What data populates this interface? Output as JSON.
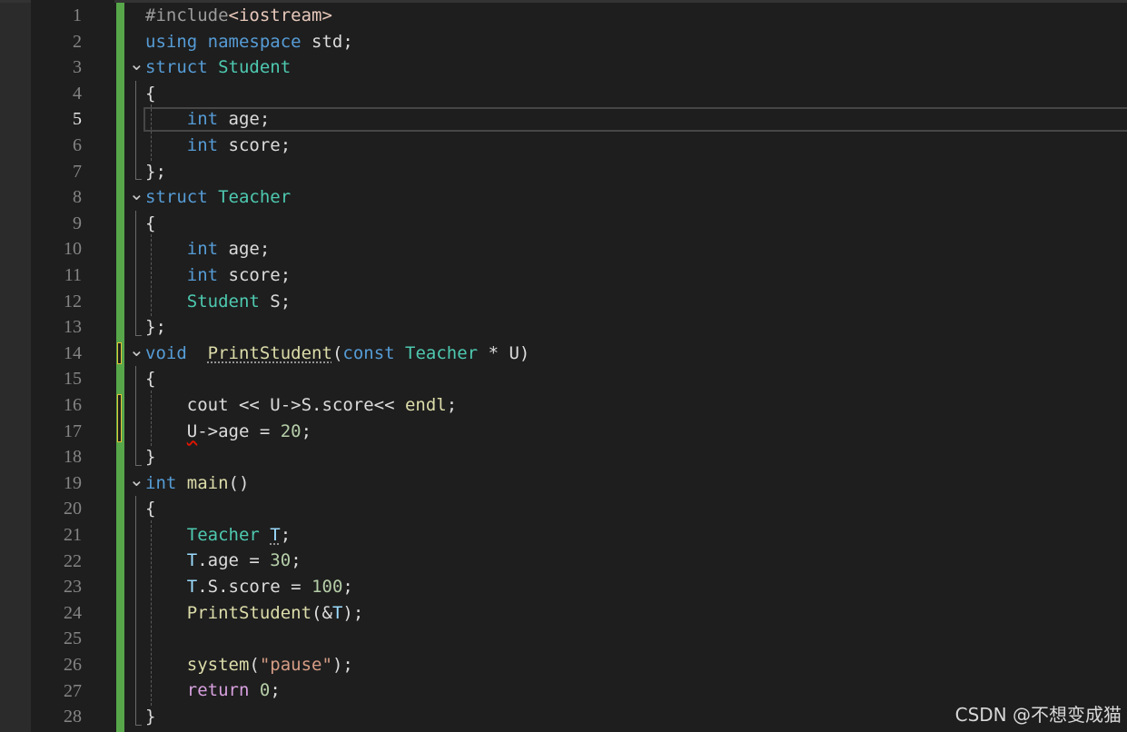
{
  "editor": {
    "current_line": 5,
    "colors": {
      "background": "#1e1e1e",
      "change_bar_saved": "#57a64a",
      "change_bar_unsaved": "#e5c23a",
      "keyword": "#569cd6",
      "type": "#4ec9b0",
      "function": "#dcdcaa",
      "string": "#d69d85",
      "number": "#b5cea8"
    },
    "lines": [
      {
        "n": "1",
        "tokens": [
          {
            "t": "#include",
            "c": "pp"
          },
          {
            "t": "<iostream>",
            "c": "inc"
          }
        ]
      },
      {
        "n": "2",
        "tokens": [
          {
            "t": "using",
            "c": "kw"
          },
          {
            "t": " ",
            "c": "id"
          },
          {
            "t": "namespace",
            "c": "kw"
          },
          {
            "t": " std;",
            "c": "id"
          }
        ]
      },
      {
        "n": "3",
        "tokens": [
          {
            "t": "struct",
            "c": "kw"
          },
          {
            "t": " ",
            "c": "id"
          },
          {
            "t": "Student",
            "c": "type"
          }
        ]
      },
      {
        "n": "4",
        "tokens": [
          {
            "t": "{",
            "c": "id"
          }
        ]
      },
      {
        "n": "5",
        "tokens": [
          {
            "t": "    ",
            "c": "id"
          },
          {
            "t": "int",
            "c": "kw"
          },
          {
            "t": " age;",
            "c": "id"
          }
        ]
      },
      {
        "n": "6",
        "tokens": [
          {
            "t": "    ",
            "c": "id"
          },
          {
            "t": "int",
            "c": "kw"
          },
          {
            "t": " score;",
            "c": "id"
          }
        ]
      },
      {
        "n": "7",
        "tokens": [
          {
            "t": "};",
            "c": "id"
          }
        ]
      },
      {
        "n": "8",
        "tokens": [
          {
            "t": "struct",
            "c": "kw"
          },
          {
            "t": " ",
            "c": "id"
          },
          {
            "t": "Teacher",
            "c": "type"
          }
        ]
      },
      {
        "n": "9",
        "tokens": [
          {
            "t": "{",
            "c": "id"
          }
        ]
      },
      {
        "n": "10",
        "tokens": [
          {
            "t": "    ",
            "c": "id"
          },
          {
            "t": "int",
            "c": "kw"
          },
          {
            "t": " age;",
            "c": "id"
          }
        ]
      },
      {
        "n": "11",
        "tokens": [
          {
            "t": "    ",
            "c": "id"
          },
          {
            "t": "int",
            "c": "kw"
          },
          {
            "t": " score;",
            "c": "id"
          }
        ]
      },
      {
        "n": "12",
        "tokens": [
          {
            "t": "    ",
            "c": "id"
          },
          {
            "t": "Student",
            "c": "type"
          },
          {
            "t": " S;",
            "c": "id"
          }
        ]
      },
      {
        "n": "13",
        "tokens": [
          {
            "t": "};",
            "c": "id"
          }
        ]
      },
      {
        "n": "14",
        "tokens": [
          {
            "t": "void",
            "c": "kw"
          },
          {
            "t": "  ",
            "c": "id"
          },
          {
            "t": "PrintStudent",
            "c": "fn",
            "deco": "dotted"
          },
          {
            "t": "(",
            "c": "id"
          },
          {
            "t": "const",
            "c": "kw"
          },
          {
            "t": " ",
            "c": "id"
          },
          {
            "t": "Teacher",
            "c": "type"
          },
          {
            "t": " * U)",
            "c": "id"
          }
        ]
      },
      {
        "n": "15",
        "tokens": [
          {
            "t": "{",
            "c": "id"
          }
        ]
      },
      {
        "n": "16",
        "tokens": [
          {
            "t": "    cout << U->S.score<< ",
            "c": "id"
          },
          {
            "t": "endl",
            "c": "fn"
          },
          {
            "t": ";",
            "c": "id"
          }
        ]
      },
      {
        "n": "17",
        "tokens": [
          {
            "t": "    ",
            "c": "id"
          },
          {
            "t": "U",
            "c": "id",
            "deco": "squiggle"
          },
          {
            "t": "->age = ",
            "c": "id"
          },
          {
            "t": "20",
            "c": "num"
          },
          {
            "t": ";",
            "c": "id"
          }
        ]
      },
      {
        "n": "18",
        "tokens": [
          {
            "t": "}",
            "c": "id"
          }
        ]
      },
      {
        "n": "19",
        "tokens": [
          {
            "t": "int",
            "c": "kw"
          },
          {
            "t": " ",
            "c": "id"
          },
          {
            "t": "main",
            "c": "fn"
          },
          {
            "t": "()",
            "c": "id"
          }
        ]
      },
      {
        "n": "20",
        "tokens": [
          {
            "t": "{",
            "c": "id"
          }
        ]
      },
      {
        "n": "21",
        "tokens": [
          {
            "t": "    ",
            "c": "id"
          },
          {
            "t": "Teacher",
            "c": "type"
          },
          {
            "t": " ",
            "c": "id"
          },
          {
            "t": "T",
            "c": "var",
            "deco": "dotted"
          },
          {
            "t": ";",
            "c": "id"
          }
        ]
      },
      {
        "n": "22",
        "tokens": [
          {
            "t": "    ",
            "c": "id"
          },
          {
            "t": "T",
            "c": "var"
          },
          {
            "t": ".age = ",
            "c": "id"
          },
          {
            "t": "30",
            "c": "num"
          },
          {
            "t": ";",
            "c": "id"
          }
        ]
      },
      {
        "n": "23",
        "tokens": [
          {
            "t": "    ",
            "c": "id"
          },
          {
            "t": "T",
            "c": "var"
          },
          {
            "t": ".S.score = ",
            "c": "id"
          },
          {
            "t": "100",
            "c": "num"
          },
          {
            "t": ";",
            "c": "id"
          }
        ]
      },
      {
        "n": "24",
        "tokens": [
          {
            "t": "    ",
            "c": "id"
          },
          {
            "t": "PrintStudent",
            "c": "fn"
          },
          {
            "t": "(&",
            "c": "id"
          },
          {
            "t": "T",
            "c": "var"
          },
          {
            "t": ");",
            "c": "id"
          }
        ]
      },
      {
        "n": "25",
        "tokens": []
      },
      {
        "n": "26",
        "tokens": [
          {
            "t": "    ",
            "c": "id"
          },
          {
            "t": "system",
            "c": "fn"
          },
          {
            "t": "(",
            "c": "id"
          },
          {
            "t": "\"pause\"",
            "c": "str"
          },
          {
            "t": ");",
            "c": "id"
          }
        ]
      },
      {
        "n": "27",
        "tokens": [
          {
            "t": "    ",
            "c": "id"
          },
          {
            "t": "return",
            "c": "ctl"
          },
          {
            "t": " ",
            "c": "id"
          },
          {
            "t": "0",
            "c": "num"
          },
          {
            "t": ";",
            "c": "id"
          }
        ]
      },
      {
        "n": "28",
        "tokens": [
          {
            "t": "}",
            "c": "id"
          }
        ]
      }
    ]
  },
  "watermark": {
    "text": "CSDN @不想变成猫"
  }
}
